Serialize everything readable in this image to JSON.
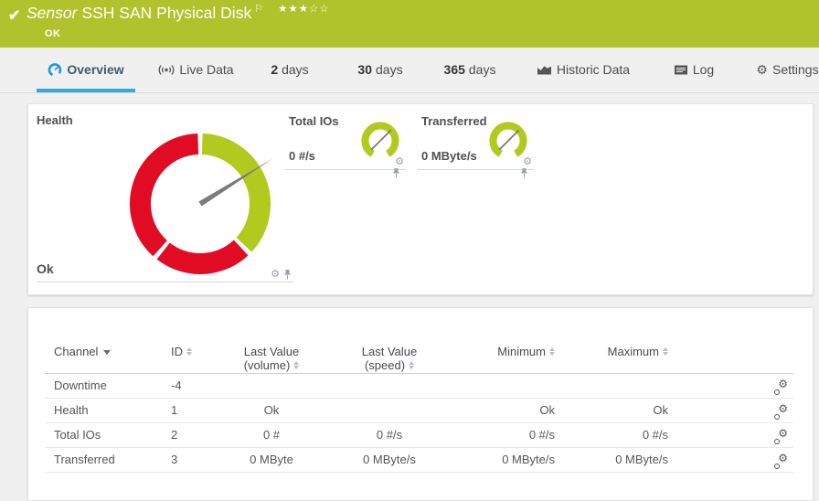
{
  "titlebar": {
    "type_label": "Sensor",
    "sensor_name": "SSH SAN Physical Disk",
    "status": "OK",
    "priority_stars": "★★★☆☆",
    "bg_color": "#b0c32c"
  },
  "icons": {
    "check": "✔",
    "flag": "⚐",
    "gear": "⚙"
  },
  "colors": {
    "ok_green": "#b0c32c",
    "gauge_green": "#b1ca1d",
    "gauge_red": "#e10c24",
    "accent_blue": "#38a8da",
    "needle_gray": "#7b7b7b"
  },
  "tabs": [
    {
      "label": "Overview",
      "active": true
    },
    {
      "label": "Live Data"
    },
    {
      "strong": "2",
      "label": "days"
    },
    {
      "strong": "30",
      "label": "days"
    },
    {
      "strong": "365",
      "label": "days"
    },
    {
      "label": "Historic Data"
    },
    {
      "label": "Log"
    },
    {
      "label": "Settings"
    }
  ],
  "gauges": {
    "health": {
      "title": "Health",
      "status_label": "Ok",
      "needle_deg": 58,
      "segments": [
        {
          "from": 2,
          "to": 133,
          "color": "#b1ca1d"
        },
        {
          "from": 137,
          "to": 218,
          "color": "#e10c24"
        },
        {
          "from": 222,
          "to": 358,
          "color": "#e10c24"
        }
      ]
    },
    "minis": [
      {
        "title": "Total IOs",
        "value": "0 #/s",
        "needle_deg": 45,
        "arc_from": -150,
        "arc_to": 150,
        "color": "#b1ca1d"
      },
      {
        "title": "Transferred",
        "value": "0 MByte/s",
        "needle_deg": 45,
        "arc_from": -150,
        "arc_to": 150,
        "color": "#b1ca1d"
      }
    ]
  },
  "channel_table": {
    "columns": [
      {
        "label": "Channel",
        "sort": "desc"
      },
      {
        "label": "ID",
        "sort": "both"
      },
      {
        "label": "Last Value",
        "label2": "(volume)",
        "sort": "both"
      },
      {
        "label": "Last Value (speed)",
        "sort": "both"
      },
      {
        "label": "Minimum",
        "sort": "both"
      },
      {
        "label": "Maximum",
        "sort": "both"
      }
    ],
    "rows": [
      {
        "channel": "Downtime",
        "id": "-4",
        "last_value_volume": "",
        "last_value_speed": "",
        "minimum": "",
        "maximum": ""
      },
      {
        "channel": "Health",
        "id": "1",
        "last_value_volume": "Ok",
        "last_value_speed": "",
        "minimum": "Ok",
        "maximum": "Ok"
      },
      {
        "channel": "Total IOs",
        "id": "2",
        "last_value_volume": "0 #",
        "last_value_speed": "0 #/s",
        "minimum": "0 #/s",
        "maximum": "0 #/s"
      },
      {
        "channel": "Transferred",
        "id": "3",
        "last_value_volume": "0 MByte",
        "last_value_speed": "0 MByte/s",
        "minimum": "0 MByte/s",
        "maximum": "0 MByte/s"
      }
    ]
  }
}
